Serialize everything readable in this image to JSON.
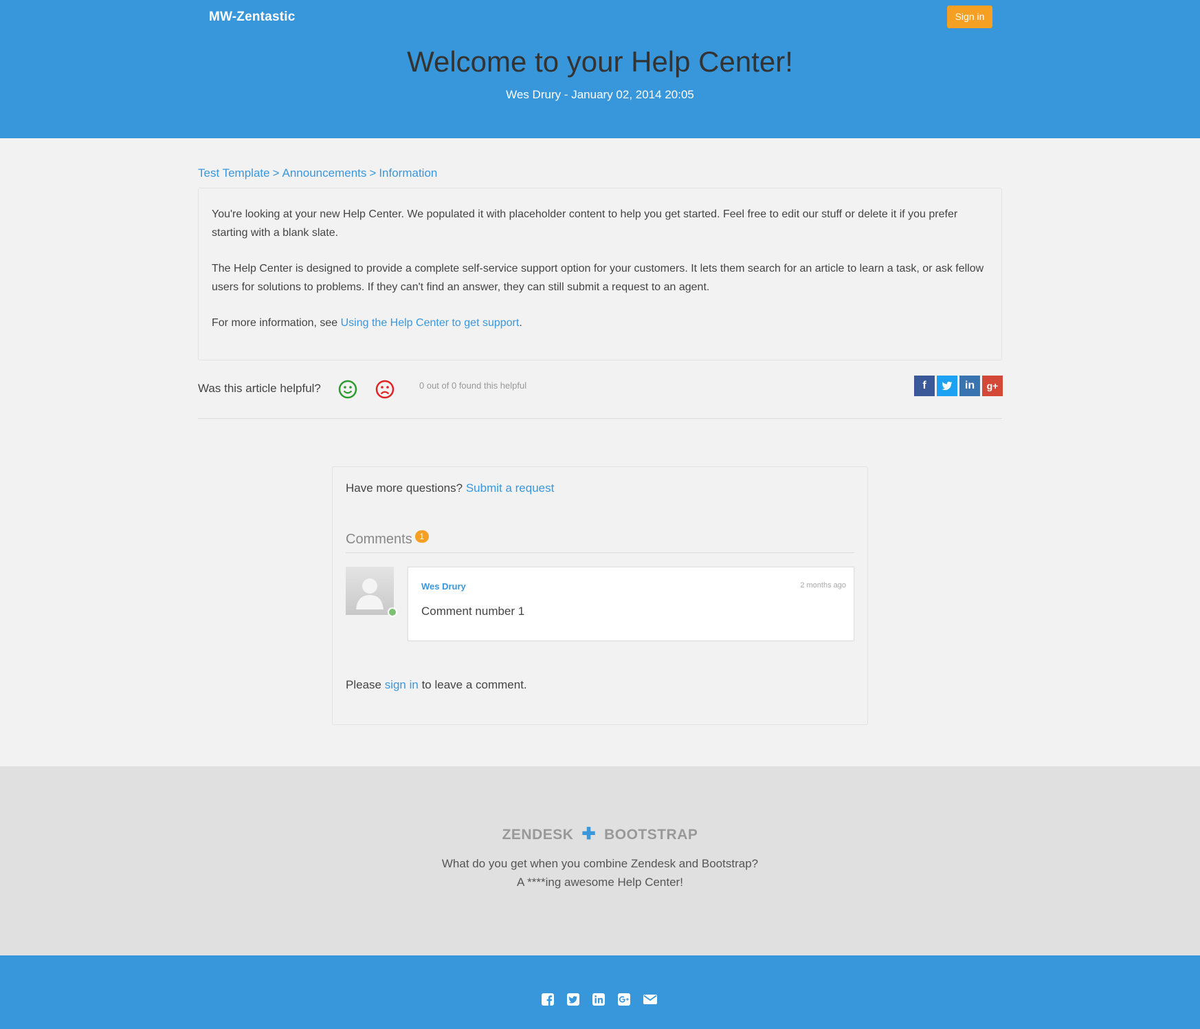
{
  "header": {
    "brand": "MW-Zentastic",
    "signin_label": "Sign in",
    "title": "Welcome to your Help Center!",
    "meta": "Wes Drury - January 02, 2014 20:05"
  },
  "breadcrumb": {
    "items": [
      "Test Template",
      "Announcements",
      "Information"
    ],
    "separator": ">"
  },
  "article": {
    "paragraph1": "You're looking at your new Help Center. We populated it with placeholder content to help you get started. Feel free to edit our stuff or delete it if you prefer starting with a blank slate.",
    "paragraph2": "The Help Center is designed to provide a complete self-service support option for your customers. It lets them search for an article to learn a task, or ask fellow users for solutions to problems. If they can't find an answer, they can still submit a request to an agent.",
    "paragraph3_prefix": "For more information, see ",
    "paragraph3_link": "Using the Help Center to get support",
    "paragraph3_suffix": "."
  },
  "helpful": {
    "question": "Was this article helpful?",
    "count_text": "0 out of 0 found this helpful",
    "share_icons": [
      "facebook-icon",
      "twitter-icon",
      "linkedin-icon",
      "google-plus-icon"
    ]
  },
  "requests": {
    "prompt": "Have more questions? ",
    "link": "Submit a request"
  },
  "comments": {
    "heading": "Comments",
    "count": "1",
    "items": [
      {
        "author": "Wes Drury",
        "time": "2 months ago",
        "body": "Comment number 1"
      }
    ],
    "signin_prefix": "Please ",
    "signin_link": "sign in",
    "signin_suffix": " to leave a comment."
  },
  "footer": {
    "brand_left": "ZENDESK",
    "brand_right": "BOOTSTRAP",
    "tagline1": "What do you get when you combine Zendesk and Bootstrap?",
    "tagline2": "A ****ing awesome Help Center!",
    "icons": [
      "facebook-icon",
      "twitter-icon",
      "linkedin-icon",
      "google-plus-icon",
      "email-icon"
    ]
  },
  "colors": {
    "primary": "#3897db",
    "accent": "#f5a023",
    "link": "#3a97dc"
  }
}
